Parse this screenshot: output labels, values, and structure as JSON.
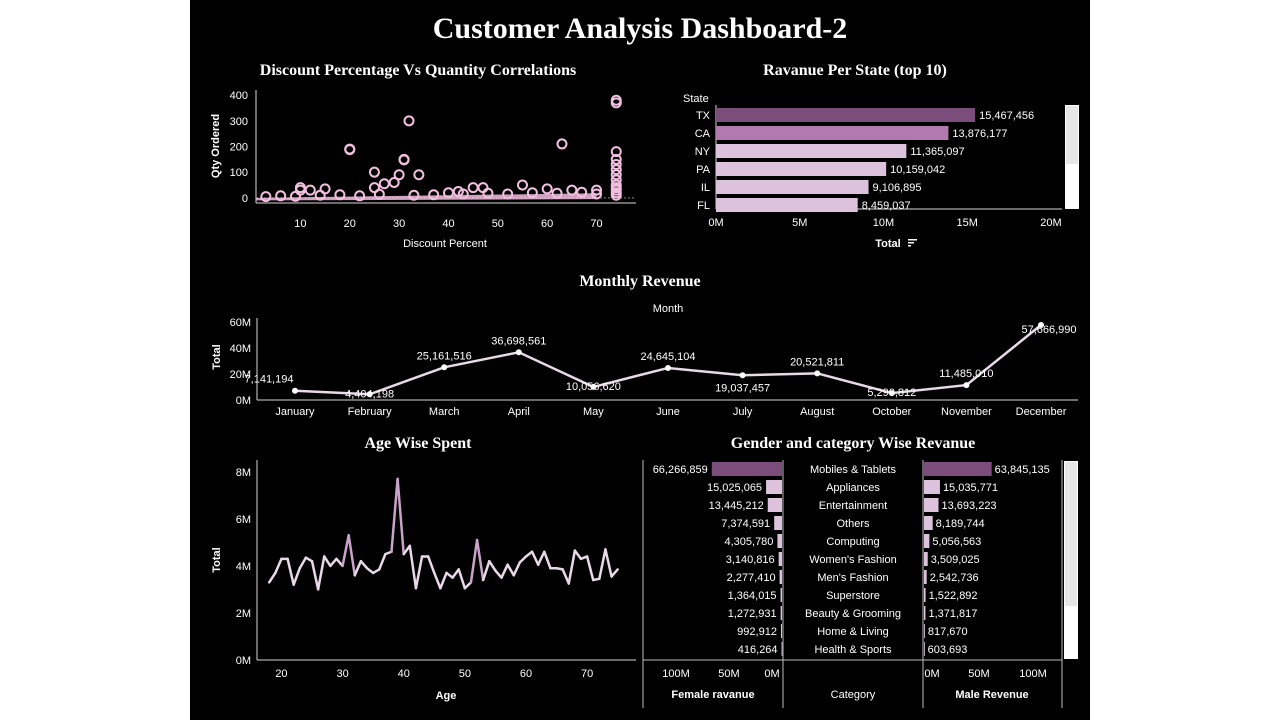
{
  "dashboard": {
    "title": "Customer Analysis Dashboard-2"
  },
  "colors": {
    "background": "#000000",
    "text": "#ffffff",
    "scatter": "#f2bfe0",
    "line": "#e8d8e8",
    "bar_dark": "#7b4d7a",
    "bar_mid": "#b07aae",
    "bar_light": "#dcc2dc"
  },
  "chart_data": [
    {
      "id": "discount_scatter",
      "type": "scatter",
      "title": "Discount Percentage Vs Quantity Correlations",
      "xlabel": "Discount Percent",
      "ylabel": "Qty Ordered",
      "xticks": [
        10,
        20,
        30,
        40,
        50,
        60,
        70
      ],
      "yticks": [
        0,
        100,
        200,
        300,
        400
      ],
      "xlim": [
        1,
        78
      ],
      "ylim": [
        -20,
        420
      ],
      "points": [
        [
          10,
          30
        ],
        [
          10,
          40
        ],
        [
          12,
          30
        ],
        [
          15,
          35
        ],
        [
          20,
          190
        ],
        [
          20,
          188
        ],
        [
          25,
          40
        ],
        [
          25,
          100
        ],
        [
          27,
          55
        ],
        [
          29,
          60
        ],
        [
          30,
          90
        ],
        [
          31,
          150
        ],
        [
          31,
          148
        ],
        [
          32,
          300
        ],
        [
          34,
          90
        ],
        [
          40,
          20
        ],
        [
          42,
          25
        ],
        [
          45,
          40
        ],
        [
          47,
          40
        ],
        [
          55,
          50
        ],
        [
          60,
          35
        ],
        [
          63,
          210
        ],
        [
          65,
          30
        ],
        [
          70,
          30
        ],
        [
          74,
          370
        ],
        [
          74,
          380
        ],
        [
          74,
          180
        ],
        [
          74,
          150
        ],
        [
          74,
          130
        ],
        [
          74,
          110
        ],
        [
          74,
          90
        ],
        [
          74,
          70
        ],
        [
          74,
          50
        ],
        [
          74,
          40
        ],
        [
          74,
          30
        ],
        [
          74,
          20
        ],
        [
          74,
          10
        ],
        [
          3,
          5
        ],
        [
          6,
          8
        ],
        [
          9,
          6
        ],
        [
          14,
          10
        ],
        [
          18,
          12
        ],
        [
          22,
          8
        ],
        [
          26,
          14
        ],
        [
          33,
          10
        ],
        [
          37,
          12
        ],
        [
          43,
          15
        ],
        [
          48,
          18
        ],
        [
          52,
          15
        ],
        [
          57,
          20
        ],
        [
          62,
          18
        ],
        [
          67,
          22
        ],
        [
          70,
          15
        ]
      ]
    },
    {
      "id": "state_revenue",
      "type": "bar",
      "title": "Ravanue Per State (top 10)",
      "column_header": "State",
      "xlabel": "Total",
      "xticks": [
        "0M",
        "5M",
        "10M",
        "15M",
        "20M"
      ],
      "xlim": [
        0,
        20000000
      ],
      "categories": [
        "TX",
        "CA",
        "NY",
        "PA",
        "IL",
        "FL"
      ],
      "values": [
        15467456,
        13876177,
        11365097,
        10159042,
        9106895,
        8459037
      ],
      "value_labels": [
        "15,467,456",
        "13,876,177",
        "11,365,097",
        "10,159,042",
        "9,106,895",
        "8,459,037"
      ]
    },
    {
      "id": "monthly_revenue",
      "type": "line",
      "title": "Monthly Revenue",
      "header": "Month",
      "ylabel": "Total",
      "yticks": [
        "0M",
        "20M",
        "40M",
        "60M"
      ],
      "ylim": [
        0,
        60000000
      ],
      "categories": [
        "January",
        "February",
        "March",
        "April",
        "May",
        "June",
        "July",
        "August",
        "October",
        "November",
        "December"
      ],
      "values": [
        7141194,
        4404198,
        25161516,
        36698561,
        10056620,
        24645104,
        19037457,
        20521811,
        5290812,
        11485010,
        57666990
      ],
      "value_labels": [
        "7,141,194",
        "4,404,198",
        "25,161,516",
        "36,698,561",
        "10,056,620",
        "24,645,104",
        "19,037,457",
        "20,521,811",
        "5,290,812",
        "11,485,010",
        "57,666,990"
      ]
    },
    {
      "id": "age_spent",
      "type": "line",
      "title": "Age Wise Spent",
      "xlabel": "Age",
      "ylabel": "Total",
      "xticks": [
        20,
        30,
        40,
        50,
        60,
        70
      ],
      "yticks": [
        "0M",
        "2M",
        "4M",
        "6M",
        "8M"
      ],
      "xlim": [
        16,
        78
      ],
      "ylim": [
        0,
        8500000
      ],
      "x": [
        18,
        19,
        20,
        21,
        22,
        23,
        24,
        25,
        26,
        27,
        28,
        29,
        30,
        31,
        32,
        33,
        34,
        35,
        36,
        37,
        38,
        39,
        40,
        41,
        42,
        43,
        44,
        45,
        46,
        47,
        48,
        49,
        50,
        51,
        52,
        53,
        54,
        55,
        56,
        57,
        58,
        59,
        60,
        61,
        62,
        63,
        64,
        65,
        66,
        67,
        68,
        69,
        70,
        71,
        72,
        73,
        74,
        75
      ],
      "values": [
        3300000,
        3700000,
        4300000,
        4300000,
        3200000,
        3900000,
        4350000,
        4200000,
        3000000,
        4400000,
        4000000,
        4300000,
        4000000,
        5300000,
        3600000,
        4200000,
        3900000,
        3700000,
        3850000,
        4500000,
        4600000,
        7700000,
        4500000,
        4850000,
        3050000,
        4400000,
        4400000,
        3700000,
        3050000,
        3700000,
        3500000,
        3850000,
        3050000,
        3300000,
        5100000,
        3400000,
        4200000,
        3800000,
        3500000,
        4050000,
        3600000,
        4150000,
        4400000,
        4600000,
        4050000,
        4600000,
        3900000,
        3900000,
        3850000,
        3250000,
        4650000,
        4300000,
        4400000,
        3400000,
        3450000,
        4700000,
        3550000,
        3850000
      ]
    },
    {
      "id": "gender_category",
      "type": "bar",
      "title": "Gender and category Wise Revanue",
      "categories": [
        "Mobiles & Tablets",
        "Appliances",
        "Entertainment",
        "Others",
        "Computing",
        "Women's Fashion",
        "Men's Fashion",
        "Superstore",
        "Beauty & Grooming",
        "Home & Living",
        "Health & Sports"
      ],
      "category_label": "Category",
      "series": [
        {
          "name": "Female ravanue",
          "values": [
            66266859,
            15025065,
            13445212,
            7374591,
            4305780,
            3140816,
            2277410,
            1364015,
            1272931,
            992912,
            416264
          ],
          "value_labels": [
            "66,266,859",
            "15,025,065",
            "13,445,212",
            "7,374,591",
            "4,305,780",
            "3,140,816",
            "2,277,410",
            "1,364,015",
            "1,272,931",
            "992,912",
            "416,264"
          ],
          "xticks": [
            "100M",
            "50M",
            "0M"
          ]
        },
        {
          "name": "Male Revenue",
          "values": [
            63845135,
            15035771,
            13693223,
            8189744,
            5056563,
            3509025,
            2542736,
            1522892,
            1371817,
            817670,
            603693
          ],
          "value_labels": [
            "63,845,135",
            "15,035,771",
            "13,693,223",
            "8,189,744",
            "5,056,563",
            "3,509,025",
            "2,542,736",
            "1,522,892",
            "1,371,817",
            "817,670",
            "603,693"
          ],
          "xticks": [
            "0M",
            "50M",
            "100M"
          ]
        }
      ]
    }
  ]
}
